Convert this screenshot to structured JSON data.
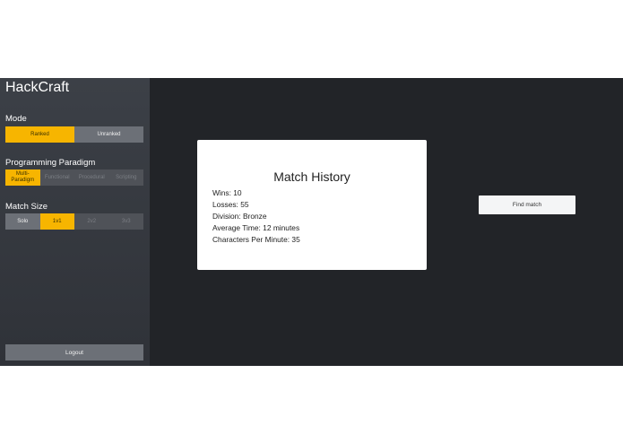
{
  "app": {
    "title": "HackCraft"
  },
  "mode": {
    "label": "Mode",
    "options": [
      "Ranked",
      "Unranked"
    ],
    "selected": "Ranked"
  },
  "paradigm": {
    "label": "Programming Paradigm",
    "options": [
      "Multi-Paradigm",
      "Functional",
      "Procedural",
      "Scripting"
    ],
    "selected": "Multi-Paradigm"
  },
  "match_size": {
    "label": "Match Size",
    "options": [
      "Solo",
      "1v1",
      "2v2",
      "3v3"
    ],
    "selected": "1v1"
  },
  "logout_label": "Logout",
  "history": {
    "title": "Match History",
    "stats": [
      "Wins: 10",
      "Losses: 55",
      "Division: Bronze",
      "Average Time: 12 minutes",
      "Characters Per Minute: 35"
    ]
  },
  "find_match_label": "Find match",
  "colors": {
    "accent": "#f7b500",
    "sidebar": "#3c4047",
    "main_bg": "#222428",
    "button": "#6c7077"
  }
}
